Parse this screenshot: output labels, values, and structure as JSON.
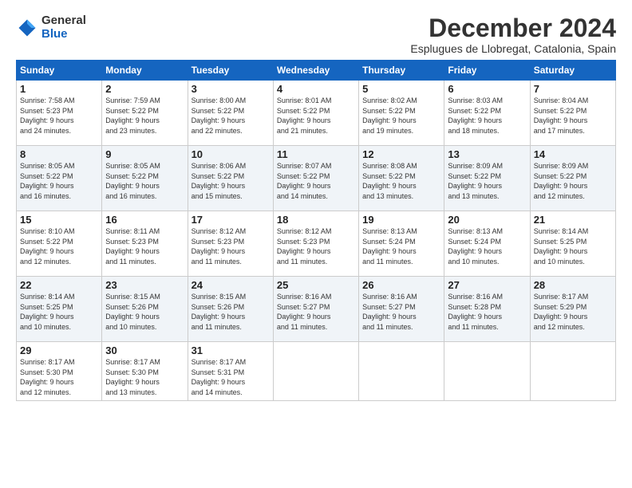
{
  "logo": {
    "general": "General",
    "blue": "Blue"
  },
  "title": "December 2024",
  "location": "Esplugues de Llobregat, Catalonia, Spain",
  "days_of_week": [
    "Sunday",
    "Monday",
    "Tuesday",
    "Wednesday",
    "Thursday",
    "Friday",
    "Saturday"
  ],
  "weeks": [
    [
      {
        "day": "1",
        "sunrise": "7:58 AM",
        "sunset": "5:23 PM",
        "daylight_hours": "9",
        "daylight_minutes": "24"
      },
      {
        "day": "2",
        "sunrise": "7:59 AM",
        "sunset": "5:22 PM",
        "daylight_hours": "9",
        "daylight_minutes": "23"
      },
      {
        "day": "3",
        "sunrise": "8:00 AM",
        "sunset": "5:22 PM",
        "daylight_hours": "9",
        "daylight_minutes": "22"
      },
      {
        "day": "4",
        "sunrise": "8:01 AM",
        "sunset": "5:22 PM",
        "daylight_hours": "9",
        "daylight_minutes": "21"
      },
      {
        "day": "5",
        "sunrise": "8:02 AM",
        "sunset": "5:22 PM",
        "daylight_hours": "9",
        "daylight_minutes": "19"
      },
      {
        "day": "6",
        "sunrise": "8:03 AM",
        "sunset": "5:22 PM",
        "daylight_hours": "9",
        "daylight_minutes": "18"
      },
      {
        "day": "7",
        "sunrise": "8:04 AM",
        "sunset": "5:22 PM",
        "daylight_hours": "9",
        "daylight_minutes": "17"
      }
    ],
    [
      {
        "day": "8",
        "sunrise": "8:05 AM",
        "sunset": "5:22 PM",
        "daylight_hours": "9",
        "daylight_minutes": "16"
      },
      {
        "day": "9",
        "sunrise": "8:05 AM",
        "sunset": "5:22 PM",
        "daylight_hours": "9",
        "daylight_minutes": "16"
      },
      {
        "day": "10",
        "sunrise": "8:06 AM",
        "sunset": "5:22 PM",
        "daylight_hours": "9",
        "daylight_minutes": "15"
      },
      {
        "day": "11",
        "sunrise": "8:07 AM",
        "sunset": "5:22 PM",
        "daylight_hours": "9",
        "daylight_minutes": "14"
      },
      {
        "day": "12",
        "sunrise": "8:08 AM",
        "sunset": "5:22 PM",
        "daylight_hours": "9",
        "daylight_minutes": "13"
      },
      {
        "day": "13",
        "sunrise": "8:09 AM",
        "sunset": "5:22 PM",
        "daylight_hours": "9",
        "daylight_minutes": "13"
      },
      {
        "day": "14",
        "sunrise": "8:09 AM",
        "sunset": "5:22 PM",
        "daylight_hours": "9",
        "daylight_minutes": "12"
      }
    ],
    [
      {
        "day": "15",
        "sunrise": "8:10 AM",
        "sunset": "5:22 PM",
        "daylight_hours": "9",
        "daylight_minutes": "12"
      },
      {
        "day": "16",
        "sunrise": "8:11 AM",
        "sunset": "5:23 PM",
        "daylight_hours": "9",
        "daylight_minutes": "11"
      },
      {
        "day": "17",
        "sunrise": "8:12 AM",
        "sunset": "5:23 PM",
        "daylight_hours": "9",
        "daylight_minutes": "11"
      },
      {
        "day": "18",
        "sunrise": "8:12 AM",
        "sunset": "5:23 PM",
        "daylight_hours": "9",
        "daylight_minutes": "11"
      },
      {
        "day": "19",
        "sunrise": "8:13 AM",
        "sunset": "5:24 PM",
        "daylight_hours": "9",
        "daylight_minutes": "11"
      },
      {
        "day": "20",
        "sunrise": "8:13 AM",
        "sunset": "5:24 PM",
        "daylight_hours": "9",
        "daylight_minutes": "10"
      },
      {
        "day": "21",
        "sunrise": "8:14 AM",
        "sunset": "5:25 PM",
        "daylight_hours": "9",
        "daylight_minutes": "10"
      }
    ],
    [
      {
        "day": "22",
        "sunrise": "8:14 AM",
        "sunset": "5:25 PM",
        "daylight_hours": "9",
        "daylight_minutes": "10"
      },
      {
        "day": "23",
        "sunrise": "8:15 AM",
        "sunset": "5:26 PM",
        "daylight_hours": "9",
        "daylight_minutes": "10"
      },
      {
        "day": "24",
        "sunrise": "8:15 AM",
        "sunset": "5:26 PM",
        "daylight_hours": "9",
        "daylight_minutes": "11"
      },
      {
        "day": "25",
        "sunrise": "8:16 AM",
        "sunset": "5:27 PM",
        "daylight_hours": "9",
        "daylight_minutes": "11"
      },
      {
        "day": "26",
        "sunrise": "8:16 AM",
        "sunset": "5:27 PM",
        "daylight_hours": "9",
        "daylight_minutes": "11"
      },
      {
        "day": "27",
        "sunrise": "8:16 AM",
        "sunset": "5:28 PM",
        "daylight_hours": "9",
        "daylight_minutes": "11"
      },
      {
        "day": "28",
        "sunrise": "8:17 AM",
        "sunset": "5:29 PM",
        "daylight_hours": "9",
        "daylight_minutes": "12"
      }
    ],
    [
      {
        "day": "29",
        "sunrise": "8:17 AM",
        "sunset": "5:30 PM",
        "daylight_hours": "9",
        "daylight_minutes": "12"
      },
      {
        "day": "30",
        "sunrise": "8:17 AM",
        "sunset": "5:30 PM",
        "daylight_hours": "9",
        "daylight_minutes": "13"
      },
      {
        "day": "31",
        "sunrise": "8:17 AM",
        "sunset": "5:31 PM",
        "daylight_hours": "9",
        "daylight_minutes": "14"
      },
      null,
      null,
      null,
      null
    ]
  ],
  "labels": {
    "sunrise": "Sunrise:",
    "sunset": "Sunset:",
    "daylight": "Daylight:",
    "hours": "hours",
    "and": "and",
    "minutes": "minutes."
  }
}
